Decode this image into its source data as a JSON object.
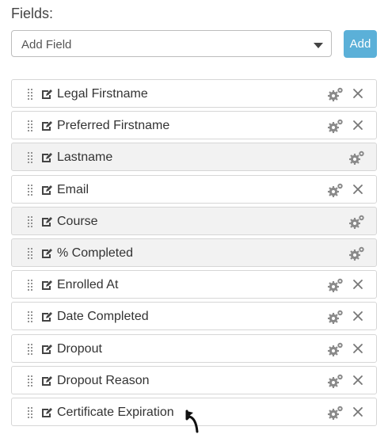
{
  "header": {
    "title": "Fields:"
  },
  "add_field": {
    "select_value": "Add Field",
    "button_label": "Add"
  },
  "fields": [
    {
      "label": "Legal Firstname",
      "removable": true
    },
    {
      "label": "Preferred Firstname",
      "removable": true
    },
    {
      "label": "Lastname",
      "removable": false
    },
    {
      "label": "Email",
      "removable": true
    },
    {
      "label": "Course",
      "removable": false
    },
    {
      "label": "% Completed",
      "removable": false
    },
    {
      "label": "Enrolled At",
      "removable": true
    },
    {
      "label": "Date Completed",
      "removable": true
    },
    {
      "label": "Dropout",
      "removable": true
    },
    {
      "label": "Dropout Reason",
      "removable": true
    },
    {
      "label": "Certificate Expiration",
      "removable": true
    }
  ],
  "icons": {
    "drag": "drag-handle-icon",
    "edit": "edit-icon",
    "settings": "gear-icon",
    "remove": "close-icon",
    "pointer": "cursor-icon"
  },
  "colors": {
    "accent": "#5bb0d8",
    "locked_row_bg": "#f2f2f2",
    "icon_gray": "#8a8a8a"
  }
}
